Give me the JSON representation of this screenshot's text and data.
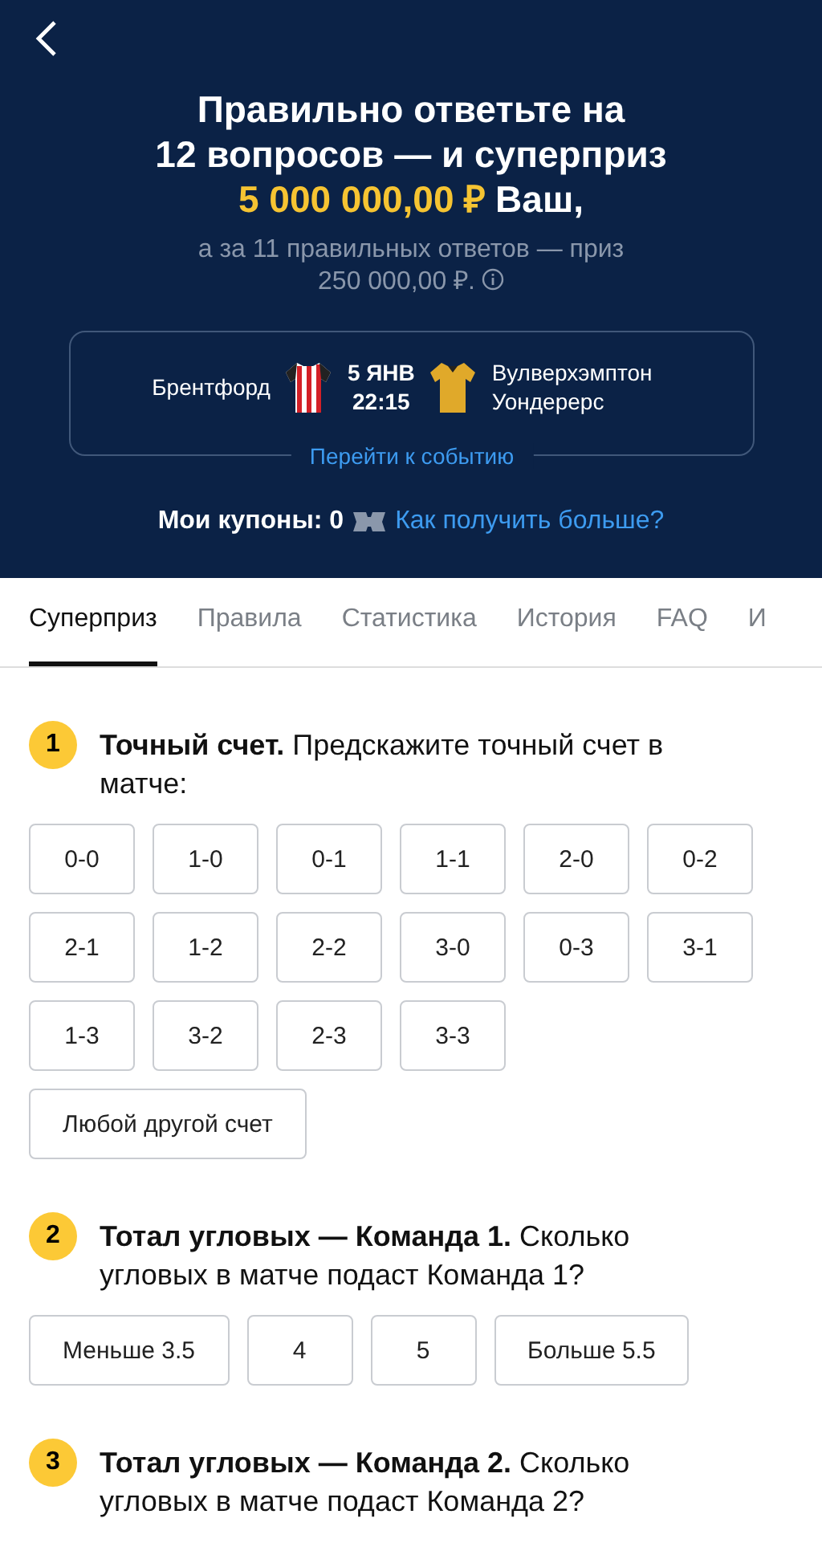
{
  "header": {
    "title_lines": [
      "Правильно ответьте на",
      "12 вопросов — и суперприз"
    ],
    "prize": "5 000 000,00 ₽",
    "prize_suffix": "Ваш,",
    "subtitle": [
      "а за 11 правильных ответов — приз",
      "250 000,00 ₽."
    ]
  },
  "event": {
    "home": "Брентфорд",
    "date": "5 ЯНВ",
    "time": "22:15",
    "away": "Вулверхэмптон Уондерерс",
    "link": "Перейти к событию"
  },
  "coupons": {
    "label": "Мои купоны: 0",
    "link": "Как получить больше?"
  },
  "tabs": [
    {
      "label": "Суперприз",
      "selected": true
    },
    {
      "label": "Правила",
      "selected": false
    },
    {
      "label": "Статистика",
      "selected": false
    },
    {
      "label": "История",
      "selected": false
    },
    {
      "label": "FAQ",
      "selected": false
    },
    {
      "label": "И",
      "selected": false
    }
  ],
  "questions": [
    {
      "number": "1",
      "text": "**Точный счет.** Предскажите точный счет в матче:",
      "options": [
        {
          "label": "0-0",
          "selected": false
        },
        {
          "label": "1-0",
          "selected": false
        },
        {
          "label": "0-1",
          "selected": false
        },
        {
          "label": "1-1",
          "selected": false
        },
        {
          "label": "2-0",
          "selected": false
        },
        {
          "label": "0-2",
          "selected": false
        },
        {
          "label": "2-1",
          "selected": false
        },
        {
          "label": "1-2",
          "selected": false
        },
        {
          "label": "2-2",
          "selected": false
        },
        {
          "label": "3-0",
          "selected": false
        },
        {
          "label": "0-3",
          "selected": false
        },
        {
          "label": "3-1",
          "selected": false
        },
        {
          "label": "1-3",
          "selected": false
        },
        {
          "label": "3-2",
          "selected": false
        },
        {
          "label": "2-3",
          "selected": false
        },
        {
          "label": "3-3",
          "selected": false
        },
        {
          "label": "Любой другой счет",
          "selected": false
        }
      ]
    },
    {
      "number": "2",
      "text": "**Тотал угловых — Команда 1.** Сколько угловых в матче подаст Команда 1?",
      "options": [
        {
          "label": "Меньше 3.5",
          "selected": false
        },
        {
          "label": "4",
          "selected": false
        },
        {
          "label": "5",
          "selected": false
        },
        {
          "label": "Больше 5.5",
          "selected": false
        }
      ]
    },
    {
      "number": "3",
      "text": "**Тотал угловых — Команда 2.** Сколько угловых в матче подаст Команда 2?"
    }
  ]
}
